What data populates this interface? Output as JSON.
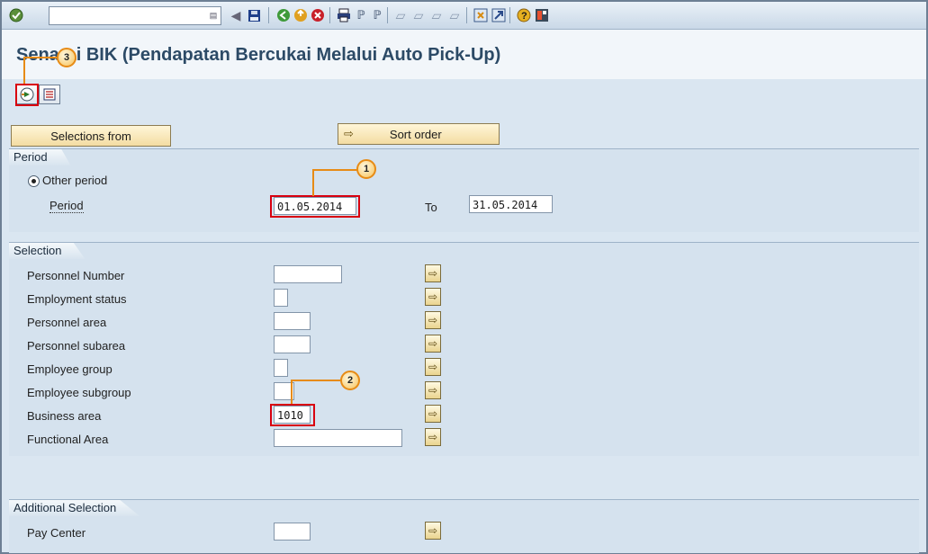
{
  "toolbar": {
    "command_field": "",
    "icons": [
      "ok-icon",
      "back-nav-icon",
      "save-icon",
      "back-icon",
      "exit-icon",
      "cancel-icon",
      "print-icon",
      "find-icon",
      "find-next-icon",
      "first-page-icon",
      "previous-page-icon",
      "next-page-icon",
      "last-page-icon",
      "new-session-icon",
      "shortcut-icon",
      "help-icon",
      "customize-layout-icon"
    ]
  },
  "title": "Senarai BIK (Pendapatan Bercukai Melalui Auto Pick-Up)",
  "app_toolbar": {
    "execute_icon": "execute-icon",
    "variant_icon": "get-variant-icon"
  },
  "buttons": {
    "selections_from": "Selections from",
    "sort_order": "Sort order"
  },
  "period_group": {
    "title": "Period",
    "radio_label": "Other period",
    "period_label": "Period",
    "from_value": "01.05.2014",
    "to_label": "To",
    "to_value": "31.05.2014"
  },
  "selection_group": {
    "title": "Selection",
    "rows": [
      {
        "label": "Personnel Number",
        "value": ""
      },
      {
        "label": "Employment status",
        "value": ""
      },
      {
        "label": "Personnel area",
        "value": ""
      },
      {
        "label": "Personnel subarea",
        "value": ""
      },
      {
        "label": "Employee group",
        "value": ""
      },
      {
        "label": "Employee subgroup",
        "value": ""
      },
      {
        "label": "Business area",
        "value": "1010"
      },
      {
        "label": "Functional Area",
        "value": ""
      }
    ]
  },
  "additional_group": {
    "title": "Additional Selection",
    "rows": [
      {
        "label": "Pay Center",
        "value": ""
      }
    ]
  },
  "callouts": [
    "1",
    "2",
    "3"
  ],
  "colors": {
    "highlight": "#d9000f",
    "callout_border": "#e78b16",
    "title_text": "#2c4a66"
  }
}
